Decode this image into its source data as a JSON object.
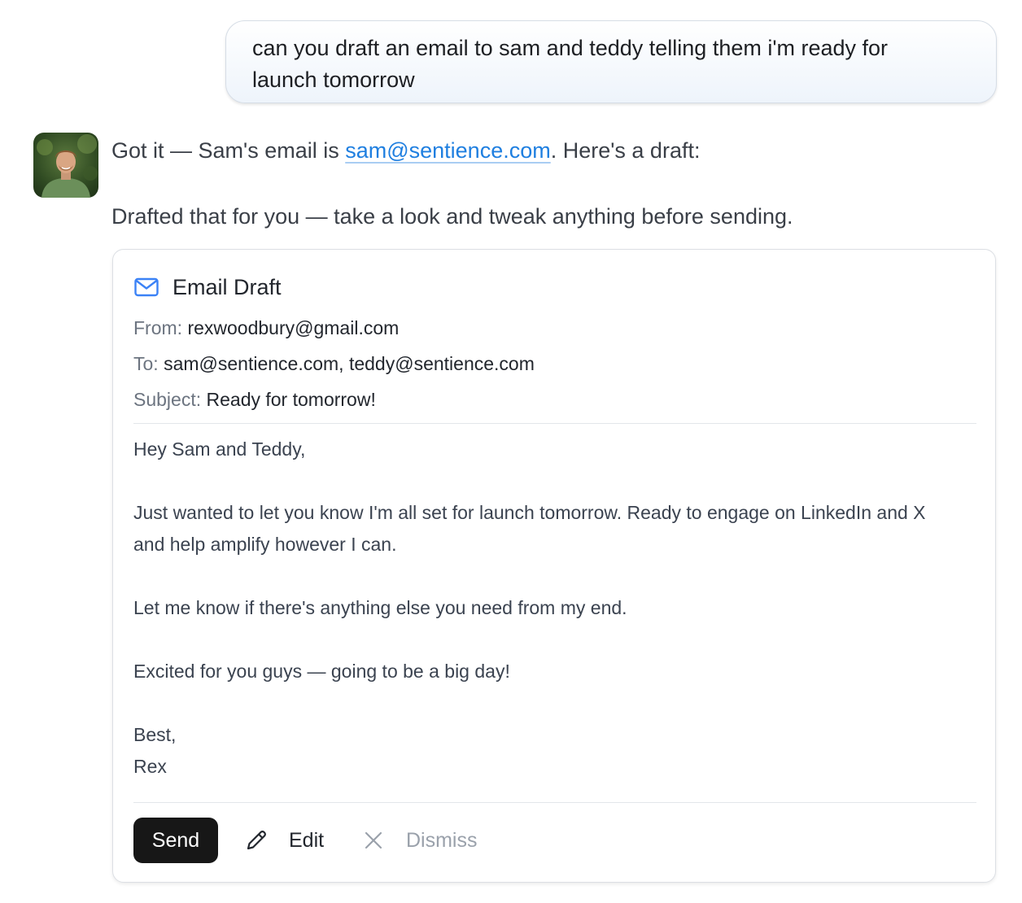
{
  "user_message": {
    "line_1": "can you draft an email to sam and teddy telling them i'm ready for",
    "line_2": "launch tomorrow"
  },
  "assistant": {
    "avatar_icon": "user-photo-avatar",
    "line_1_prefix": "Got it — Sam's email is ",
    "line_1_link": "sam@sentience.com",
    "line_1_suffix": ". Here's a draft:",
    "line_2": "Drafted that for you — take a look and tweak anything before sending."
  },
  "draft": {
    "icon": "mail-icon",
    "title": "Email Draft",
    "from_label": "From:",
    "from_value": "rexwoodbury@gmail.com",
    "to_label": "To:",
    "to_value": "sam@sentience.com, teddy@sentience.com",
    "subject_label": "Subject:",
    "subject_value": "Ready for tomorrow!",
    "body": [
      "Hey Sam and Teddy,",
      "Just wanted to let you know I'm all set for launch tomorrow. Ready to engage on LinkedIn and X",
      "and help amplify however I can.",
      "Let me know if there's anything else you need from my end.",
      "Excited for you guys — going to be a big day!",
      "Best,",
      "Rex"
    ],
    "send_label": "Send",
    "edit_label": "Edit",
    "dismiss_label": "Dismiss"
  },
  "colors": {
    "link": "#1f7fe0",
    "send_bg": "#171717",
    "mail_icon": "#3b82f6",
    "dismiss_text": "#9aa1ab"
  }
}
